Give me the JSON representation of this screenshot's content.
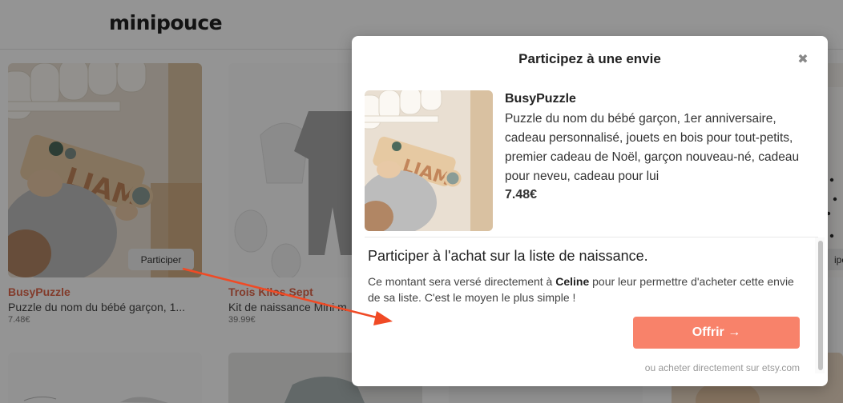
{
  "header": {
    "logo": "minipouce"
  },
  "cards": [
    {
      "shop": "BusyPuzzle",
      "desc": "Puzzle du nom du bébé garçon, 1...",
      "price": "7.48€",
      "button": "Participer"
    },
    {
      "shop": "Trois Kilos Sept",
      "desc": "Kit de naissance Mini m",
      "price": "39.99€"
    },
    {
      "button": "ipe"
    }
  ],
  "modal": {
    "title": "Participez à une envie",
    "close_icon": "close-icon",
    "product": {
      "shop": "BusyPuzzle",
      "description": "Puzzle du nom du bébé garçon, 1er anniversaire, cadeau personnalisé, jouets en bois pour tout-petits, premier cadeau de Noël, garçon nouveau-né, cadeau pour neveu, cadeau pour lui",
      "price": "7.48€"
    },
    "panel": {
      "title": "Participer à l'achat sur la liste de naissance.",
      "text_before": "Ce montant sera versé directement à ",
      "recipient": "Celine",
      "text_after": " pour leur permettre d'acheter cette envie de sa liste. C'est le moyen le plus simple !",
      "offer_label": "Offrir →",
      "etsy_link": "ou acheter directement sur etsy.com"
    }
  },
  "colors": {
    "accent": "#f8826a",
    "brand_text": "#e0674b",
    "annotation": "#f04a25"
  }
}
